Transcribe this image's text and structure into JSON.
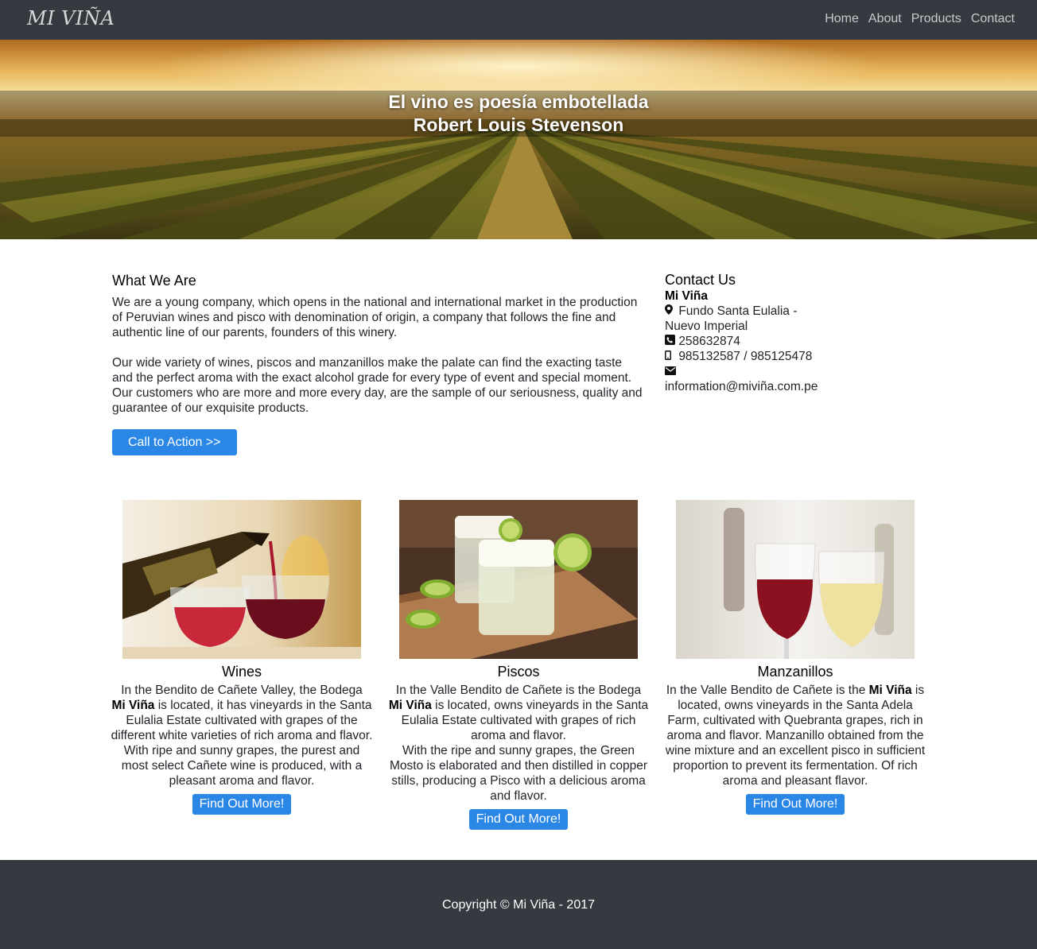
{
  "nav": {
    "brand": "MI VIÑA",
    "links": [
      "Home",
      "About",
      "Products",
      "Contact"
    ]
  },
  "hero": {
    "quote": "El vino es poesía embotellada",
    "author": "Robert Louis Stevenson"
  },
  "about": {
    "heading": "What We Are",
    "para1": "We are a young company, which opens in the national and international market in the production of Peruvian wines and pisco with denomination of origin, a company that follows the fine and authentic line of our parents, founders of this winery.",
    "para2": "Our wide variety of wines, piscos and manzanillos make the palate can find the exacting taste and the perfect aroma with the exact alcohol grade for every type of event and special moment. Our customers who are more and more every day, are the sample of our seriousness, quality and guarantee of our exquisite products.",
    "cta": "Call to Action >>"
  },
  "contact": {
    "heading": "Contact Us",
    "company": "Mi Viña",
    "address": "Fundo Santa Eulalia - Nuevo Imperial",
    "phone": "258632874",
    "mobile": "985132587 / 985125478",
    "email": "information@miviña.com.pe",
    "icons": [
      "map-marker-icon",
      "phone-square-icon",
      "mobile-icon",
      "envelope-icon"
    ]
  },
  "products": [
    {
      "title": "Wines",
      "line1_pre": "In the Bendito de Cañete Valley, the Bodega",
      "brand": "Mi Viña",
      "line1_post": " is located, it has vineyards in the Santa Eulalia Estate cultivated with grapes of the different white varieties of rich aroma and flavor.",
      "line2": "With ripe and sunny grapes, the purest and most select Cañete wine is produced, with a pleasant aroma and flavor.",
      "button": "Find Out More!"
    },
    {
      "title": "Piscos",
      "line1_pre": "In the Valle Bendito de Cañete is the Bodega",
      "brand": "Mi Viña",
      "line1_post": " is located, owns vineyards in the Santa Eulalia Estate cultivated with grapes of rich aroma and flavor.",
      "line2": "With the ripe and sunny grapes, the Green Mosto is elaborated and then distilled in copper stills, producing a Pisco with a delicious aroma and flavor.",
      "button": "Find Out More!"
    },
    {
      "title": "Manzanillos",
      "line1_pre": "In the Valle Bendito de Cañete is the ",
      "brand": "Mi Viña",
      "line1_post": " is located, owns vineyards in the Santa Adela Farm, cultivated with Quebranta grapes, rich in aroma and flavor. Manzanillo obtained from the wine mixture and an excellent pisco in sufficient proportion to prevent its fermentation. Of rich aroma and pleasant flavor.",
      "line2": "",
      "button": "Find Out More!"
    }
  ],
  "footer": {
    "copyright": "Copyright © Mi Viña - 2017"
  },
  "colors": {
    "navbar": "#343a40",
    "accent": "#2b87e6"
  }
}
